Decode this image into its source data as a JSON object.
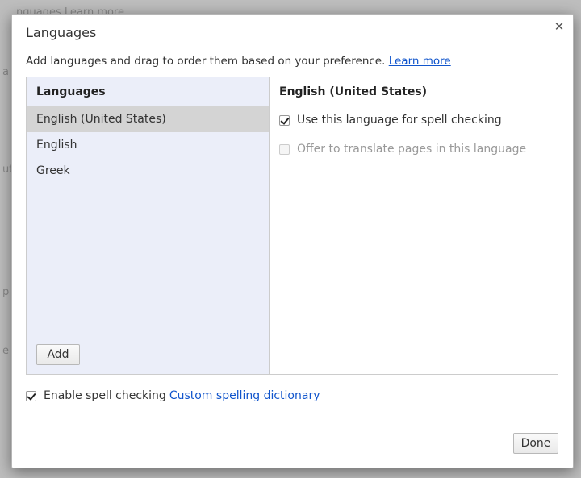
{
  "background": {
    "fragments": [
      "nguages  Learn more",
      "a",
      "ut",
      "p",
      "e"
    ]
  },
  "dialog": {
    "title": "Languages",
    "close_icon": "close-icon",
    "intro_text": "Add languages and drag to order them based on your preference.",
    "learn_more": "Learn more"
  },
  "languages_pane": {
    "header": "Languages",
    "items": [
      {
        "label": "English (United States)",
        "selected": true
      },
      {
        "label": "English",
        "selected": false
      },
      {
        "label": "Greek",
        "selected": false
      }
    ],
    "add_label": "Add"
  },
  "detail_pane": {
    "header": "English (United States)",
    "spell_check_label": "Use this language for spell checking",
    "spell_check_checked": true,
    "translate_label": "Offer to translate pages in this language",
    "translate_checked": false,
    "translate_enabled": false
  },
  "footer": {
    "enable_spell_label": "Enable spell checking",
    "enable_spell_checked": true,
    "custom_dictionary_link": "Custom spelling dictionary",
    "done_label": "Done"
  },
  "colors": {
    "link": "#1155cc",
    "list_pane_bg": "#ebeef9",
    "selected_item_bg": "#d4d4d4"
  }
}
